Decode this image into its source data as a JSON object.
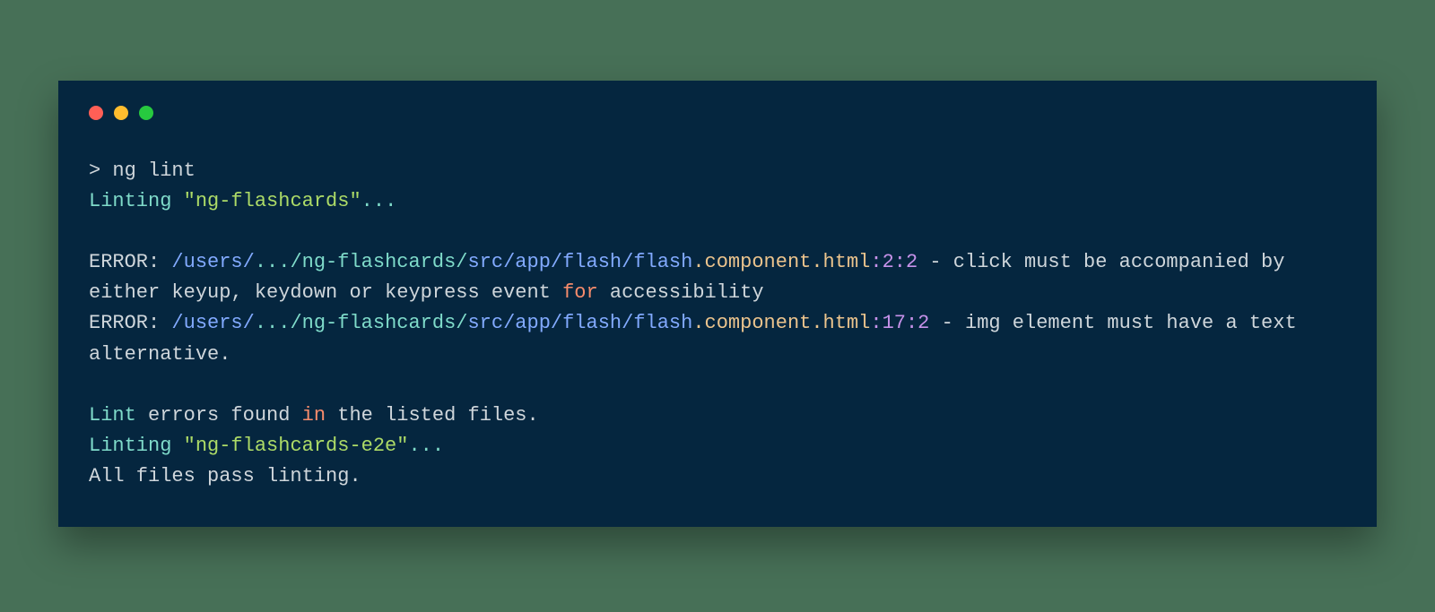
{
  "prompt": "> ng lint",
  "lines": {
    "linting1_prefix": "Linting ",
    "project1_name": "\"ng-flashcards\"",
    "linting_suffix": "...",
    "error_label": "ERROR: ",
    "path_seg1": "/users/",
    "path_seg2": ".../ng-flashcards/",
    "path_seg3": "src/app/flash/flash",
    "component_html": ".component.html",
    "loc1": ":2:2",
    "msg1a": " - click must be accompanied by either keyup, keydown or keypress event ",
    "for_kw": "for",
    "msg1b": " accessibility",
    "loc2": ":17:2",
    "msg2": " - img element must have a text alternative.",
    "lint_word": "Lint",
    "errors_found_a": " errors found ",
    "in_kw": "in",
    "errors_found_b": " the listed files.",
    "project2_name": "\"ng-flashcards-e2e\"",
    "all_pass": "All files pass linting."
  }
}
